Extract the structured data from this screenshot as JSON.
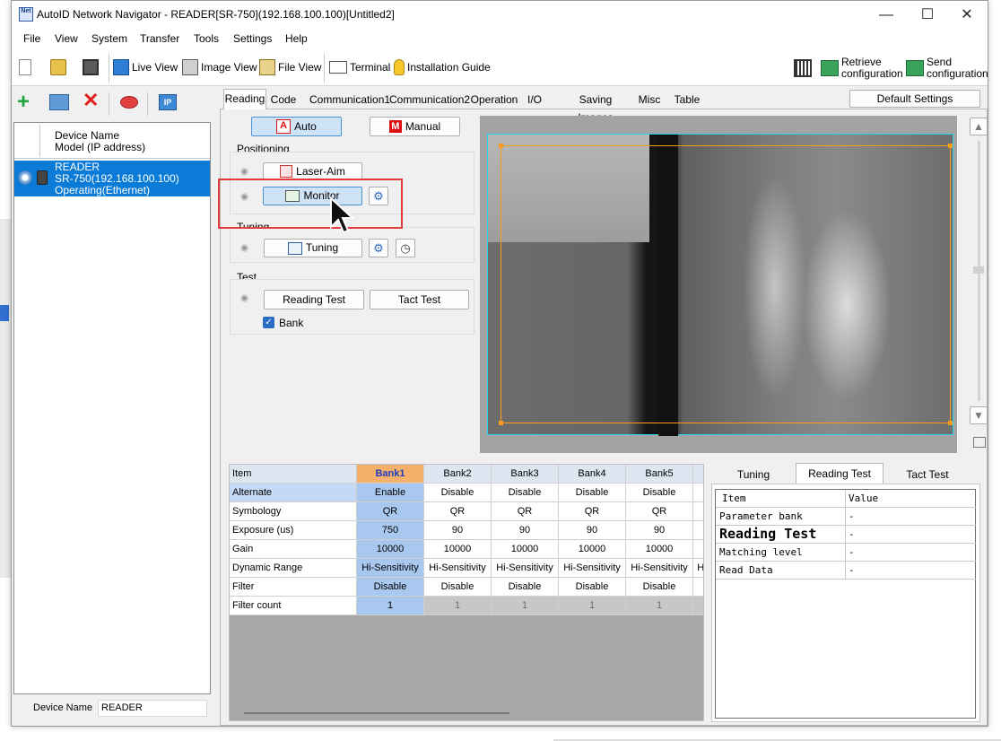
{
  "window": {
    "title": "AutoID Network Navigator - READER[SR-750](192.168.100.100)[Untitled2]",
    "app_icon_text": "Net"
  },
  "menu": [
    "File",
    "View",
    "System",
    "Transfer",
    "Tools",
    "Settings",
    "Help"
  ],
  "toolbar": {
    "live_view": "Live View",
    "image_view": "Image View",
    "file_view": "File View",
    "terminal": "Terminal",
    "installation_guide": "Installation Guide",
    "retrieve": [
      "Retrieve",
      "configuration"
    ],
    "send": [
      "Send",
      "configuration"
    ]
  },
  "device_list": {
    "header_name": "Device Name",
    "header_model": "Model (IP address)",
    "device_name": "READER",
    "device_model": "SR-750(192.168.100.100)",
    "device_status": "Operating(Ethernet)"
  },
  "footer": {
    "device_name_label": "Device Name",
    "device_name_value": "READER"
  },
  "tabs": [
    "Reading",
    "Code",
    "Communication1",
    "Communication2",
    "Operation",
    "I/O",
    "Saving Images",
    "Misc",
    "Table"
  ],
  "active_tab": "Reading",
  "default_settings": "Default Settings",
  "reading": {
    "auto": "Auto",
    "manual": "Manual",
    "positioning_label": "Positioning",
    "laser_aim": "Laser-Aim",
    "monitor": "Monitor",
    "tuning_label": "Tuning",
    "tuning_btn": "Tuning",
    "test_label": "Test",
    "reading_test": "Reading Test",
    "tact_test": "Tact Test",
    "bank_checkbox": "Bank",
    "bank_checked": true
  },
  "bank_table": {
    "headers": [
      "Item",
      "Bank1",
      "Bank2",
      "Bank3",
      "Bank4",
      "Bank5"
    ],
    "rows": [
      {
        "item": "Alternate",
        "values": [
          "Enable",
          "Disable",
          "Disable",
          "Disable",
          "Disable"
        ]
      },
      {
        "item": "Symbology",
        "values": [
          "QR",
          "QR",
          "QR",
          "QR",
          "QR"
        ]
      },
      {
        "item": "Exposure (us)",
        "values": [
          "750",
          "90",
          "90",
          "90",
          "90"
        ]
      },
      {
        "item": "Gain",
        "values": [
          "10000",
          "10000",
          "10000",
          "10000",
          "10000"
        ]
      },
      {
        "item": "Dynamic Range",
        "values": [
          "Hi-Sensitivity",
          "Hi-Sensitivity",
          "Hi-Sensitivity",
          "Hi-Sensitivity",
          "Hi-Sensitivity"
        ]
      },
      {
        "item": "Filter",
        "values": [
          "Disable",
          "Disable",
          "Disable",
          "Disable",
          "Disable"
        ]
      },
      {
        "item": "Filter count",
        "values": [
          "1",
          "1",
          "1",
          "1",
          "1"
        ]
      }
    ],
    "overflow_text": "Hi"
  },
  "result_panel": {
    "tabs": [
      "Tuning",
      "Reading Test",
      "Tact Test"
    ],
    "active_tab": "Reading Test",
    "headers": [
      "Item",
      "Value"
    ],
    "rows": [
      {
        "item": "Parameter bank",
        "value": "-"
      },
      {
        "item": "Reading Test",
        "value": "-"
      },
      {
        "item": "Matching level",
        "value": "-"
      },
      {
        "item": "Read Data",
        "value": "-"
      }
    ]
  },
  "colors": {
    "accent": "#4f8fd6",
    "highlight_box": "#e23b3b",
    "roi": "#ff9a1c",
    "bank1_header": "#f5b06c"
  }
}
